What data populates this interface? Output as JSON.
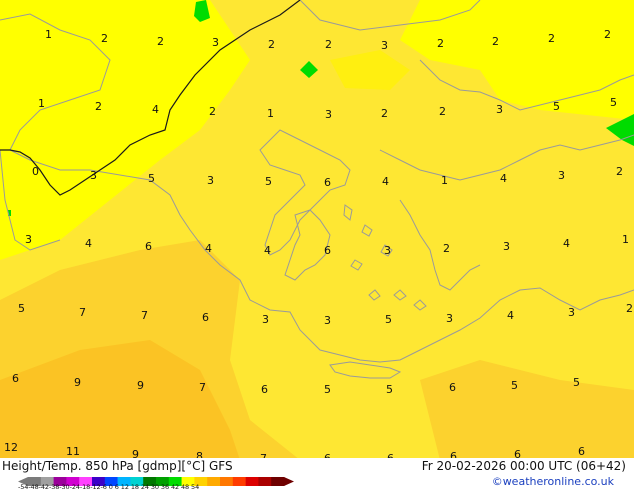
{
  "footer": {
    "title": "Height/Temp. 850 hPa [gdmp][°C] GFS",
    "datetime": "Fr 20-02-2026 00:00 UTC (06+42)",
    "credit": "©weatheronline.co.uk"
  },
  "colorbar": {
    "tick_labels": "-54-48-42-38-30-24-18-12-6  0  6  12 18 24 30 36 42 48 54",
    "colors": [
      "#7b7b7b",
      "#a0a0a0",
      "#9b009b",
      "#d000d0",
      "#ff40ff",
      "#3b00c8",
      "#0046ff",
      "#00b4ff",
      "#00d2d2",
      "#007800",
      "#00a000",
      "#00dc00",
      "#ffff00",
      "#ffd200",
      "#ffaa00",
      "#ff7800",
      "#ff3c00",
      "#dc0000",
      "#aa0000",
      "#6e0000"
    ]
  },
  "map": {
    "colors": {
      "yellow": "#ffff00",
      "yellow_orange": "#fee733",
      "light_orange": "#fcd22e",
      "orange": "#fbc324",
      "green": "#00dc00",
      "coast": "#9a9a9a",
      "border": "#1a1a1a"
    },
    "values": [
      "1",
      "2",
      "2",
      "3",
      "2",
      "2",
      "3",
      "2",
      "2",
      "2",
      "2",
      "1",
      "2",
      "4",
      "2",
      "1",
      "3",
      "2",
      "2",
      "3",
      "5",
      "5",
      "0",
      "3",
      "5",
      "3",
      "5",
      "6",
      "4",
      "1",
      "4",
      "3",
      "2",
      "3",
      "4",
      "6",
      "4",
      "4",
      "6",
      "3",
      "2",
      "3",
      "4",
      "1",
      "5",
      "7",
      "7",
      "6",
      "3",
      "3",
      "5",
      "3",
      "4",
      "3",
      "2",
      "6",
      "9",
      "9",
      "7",
      "6",
      "5",
      "5",
      "6",
      "5",
      "5",
      "12",
      "11",
      "9",
      "8",
      "7",
      "6",
      "6",
      "6",
      "6",
      "6"
    ]
  }
}
